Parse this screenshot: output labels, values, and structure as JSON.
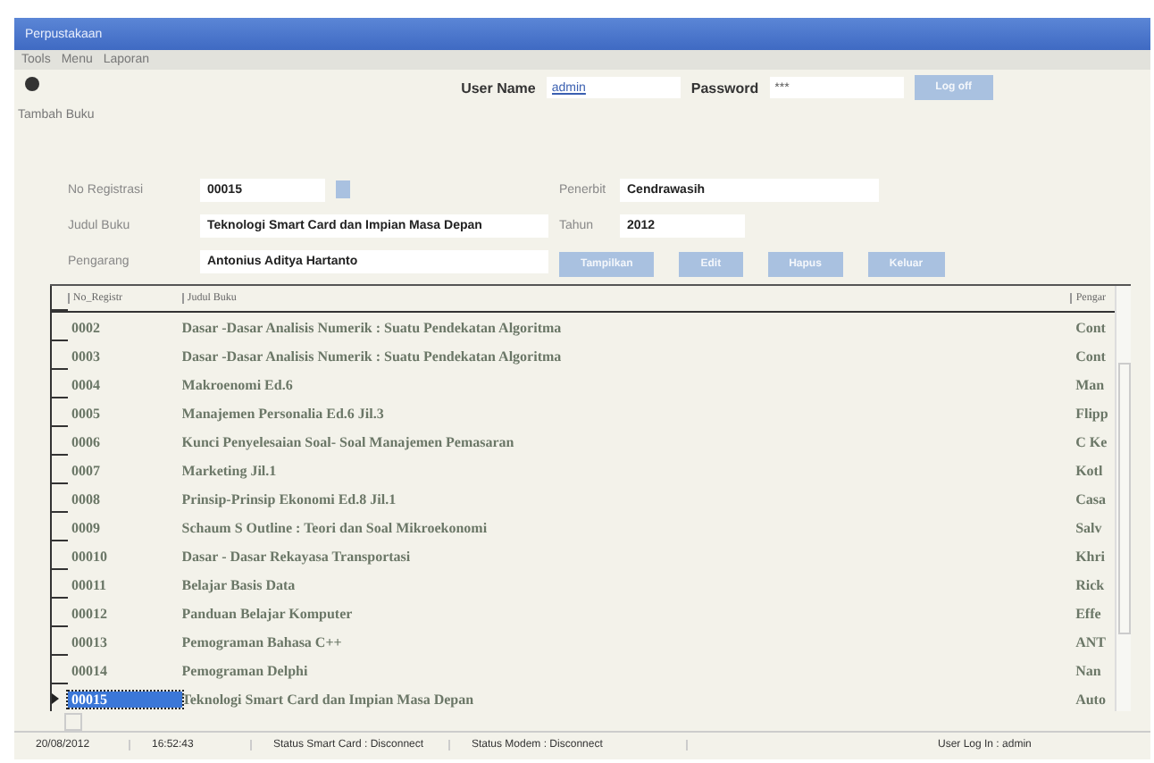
{
  "window": {
    "title": "Perpustakaan"
  },
  "menu": [
    {
      "label": "Tools"
    },
    {
      "label": "Menu"
    },
    {
      "label": "Laporan"
    }
  ],
  "login": {
    "user_label": "User Name",
    "user_value": "admin",
    "password_label": "Password",
    "password_value": "***",
    "button": "Log off"
  },
  "section_title": "Tambah Buku",
  "form": {
    "left": [
      {
        "label": "No Registrasi",
        "value": "00015",
        "kind": "lookup"
      },
      {
        "label": "Judul Buku",
        "value": "Teknologi Smart Card dan Impian Masa Depan",
        "kind": "text"
      },
      {
        "label": "Pengarang",
        "value": "Antonius Aditya Hartanto",
        "kind": "text"
      }
    ],
    "right": [
      {
        "label": "Penerbit",
        "value": "Cendrawasih"
      },
      {
        "label": "Tahun",
        "value": "2012"
      }
    ],
    "buttons": [
      "Tampilkan",
      "Edit",
      "Hapus",
      "Keluar"
    ]
  },
  "table": {
    "columns": [
      "No_Registr",
      "Judul Buku",
      "Pengar"
    ],
    "rows": [
      {
        "cells": [
          "0002",
          "Dasar -Dasar Analisis Numerik : Suatu Pendekatan Algoritma",
          "Cont"
        ],
        "selected": false
      },
      {
        "cells": [
          "0003",
          "Dasar -Dasar Analisis Numerik : Suatu Pendekatan Algoritma",
          "Cont"
        ],
        "selected": false
      },
      {
        "cells": [
          "0004",
          "Makroenomi Ed.6",
          "Man"
        ],
        "selected": false
      },
      {
        "cells": [
          "0005",
          "Manajemen Personalia Ed.6 Jil.3",
          "Flipp"
        ],
        "selected": false
      },
      {
        "cells": [
          "0006",
          "Kunci Penyelesaian Soal- Soal Manajemen Pemasaran",
          "C Ke"
        ],
        "selected": false
      },
      {
        "cells": [
          "0007",
          "Marketing Jil.1",
          "Kotl"
        ],
        "selected": false
      },
      {
        "cells": [
          "0008",
          "Prinsip-Prinsip Ekonomi Ed.8 Jil.1",
          "Casa"
        ],
        "selected": false
      },
      {
        "cells": [
          "0009",
          "Schaum S Outline : Teori dan Soal Mikroekonomi",
          "Salv"
        ],
        "selected": false
      },
      {
        "cells": [
          "00010",
          "Dasar - Dasar Rekayasa Transportasi",
          "Khri"
        ],
        "selected": false
      },
      {
        "cells": [
          "00011",
          "Belajar Basis Data",
          "Rick"
        ],
        "selected": false
      },
      {
        "cells": [
          "00012",
          "Panduan Belajar Komputer",
          "Effe"
        ],
        "selected": false
      },
      {
        "cells": [
          "00013",
          "Pemograman Bahasa C++",
          "ANT"
        ],
        "selected": false
      },
      {
        "cells": [
          "00014",
          "Pemograman Delphi",
          "Nan"
        ],
        "selected": false
      },
      {
        "cells": [
          "00015",
          "Teknologi Smart Card dan Impian Masa Depan",
          "Auto"
        ],
        "selected": true
      }
    ]
  },
  "status_bar": [
    "20/08/2012",
    "16:52:43",
    "Status Smart Card : Disconnect",
    "Status Modem : Disconnect",
    "User Log In : admin"
  ]
}
